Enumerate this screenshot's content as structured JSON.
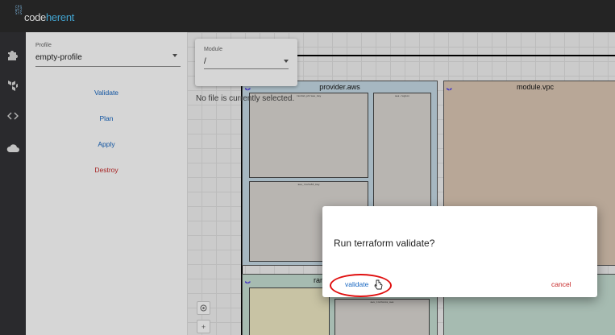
{
  "header": {
    "logo_small_lines": [
      "CPS",
      "WYZ",
      "SYS"
    ],
    "logo_main": "code",
    "logo_accent": "herent"
  },
  "rail": {
    "icons": [
      "puzzle-icon",
      "terraform-icon",
      "code-brackets-icon",
      "cloud-icon"
    ]
  },
  "panel": {
    "profile_label": "Profile",
    "profile_value": "empty-profile",
    "actions": [
      "Validate",
      "Plan",
      "Apply",
      "Destroy"
    ]
  },
  "module_select": {
    "label": "Module",
    "value": "/"
  },
  "canvas": {
    "no_file_text": "No file is currently selected.",
    "provider_title": "provider.aws",
    "vpc_title": "module.vpc",
    "lower_title": "ran",
    "mini_labels": [
      "random_phrase_key",
      "aws.region",
      "aws_route53_key",
      "aws_instance_aws"
    ]
  },
  "zoom": {
    "center_icon": "target-icon",
    "zoom_in": "+"
  },
  "dialog": {
    "title": "Run terraform validate?",
    "confirm_label": "validate",
    "cancel_label": "cancel"
  },
  "colors": {
    "accent": "#1565c0",
    "danger": "#c62828",
    "highlight": "#e01010"
  }
}
